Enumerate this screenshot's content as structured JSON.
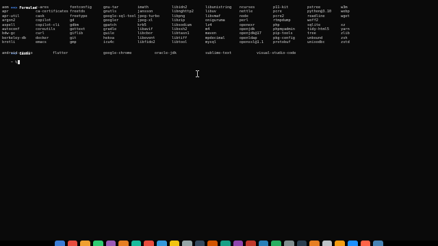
{
  "formulae": {
    "arrow": "==>",
    "title": "Formulae",
    "rows": [
      [
        "aom",
        "c-ares",
        "fontconfig",
        "gnu-tar",
        "imath",
        "libidn2",
        "libunistring",
        "ncurses",
        "p11-kit",
        "pstree",
        "w3m"
      ],
      [
        "apr",
        "ca-certificates",
        "freetds",
        "gnutls",
        "jansson",
        "libnghttp2",
        "libuv",
        "nettle",
        "pcre",
        "python@3.10",
        "webp"
      ],
      [
        "apr-util",
        "cask",
        "freetype",
        "google-sql-tool",
        "jpeg-turbo",
        "libpng",
        "libvmaf",
        "node",
        "pcre2",
        "readline",
        "wget"
      ],
      [
        "argon2",
        "copilot",
        "gd",
        "googler",
        "jpeg-xl",
        "libzip",
        "oniguruma",
        "perl",
        "rtmpdump",
        "woff2"
      ],
      [
        "aspell",
        "copilot-cli",
        "gdbm",
        "gpatch",
        "krb5",
        "libsodium",
        "lz4",
        "openexr",
        "php",
        "sqlite",
        "xz"
      ],
      [
        "autoconf",
        "coreutils",
        "gettext",
        "gradle",
        "libavif",
        "libssh2",
        "m4",
        "openjdk",
        "phpmyadmin",
        "tidy-html5",
        "yarn"
      ],
      [
        "bdw-gc",
        "curl",
        "giflib",
        "guile",
        "libcbor",
        "libtasn1",
        "maven",
        "openjdk@17",
        "pip-tools",
        "tree",
        "zlib"
      ],
      [
        "berkeley-db",
        "docker",
        "git",
        "hekxa",
        "libevent",
        "libtiff",
        "mpdecimal",
        "openldap",
        "pkg-config",
        "unbound",
        "zsh"
      ],
      [
        "brotli",
        "emacs",
        "gmp",
        "icu4c",
        "libfido2",
        "libtool",
        "mysql",
        "openssl@1.1",
        "protobuf",
        "unixodbc",
        "zstd"
      ]
    ]
  },
  "casks": {
    "arrow": "==>",
    "title": "Casks",
    "items": [
      "android-studio",
      "flutter",
      "google-chrome",
      "oracle-jdk",
      "sublime-text",
      "visual-studio-code"
    ]
  },
  "prompt": {
    "text": "~ %"
  },
  "dock": {
    "icon_colors": [
      "#3a7bd5",
      "#e84c3d",
      "#f0a030",
      "#2ecc71",
      "#9b59b6",
      "#e67e22",
      "#1abc9c",
      "#e74c3c",
      "#3498db",
      "#f1c40f",
      "#95a5a6",
      "#34495e",
      "#d35400",
      "#16a085",
      "#8e44ad",
      "#c0392b",
      "#2980b9",
      "#27ae60",
      "#7f8c8d",
      "#2c3e50",
      "#e67e22",
      "#bdc3c7",
      "#f39c12",
      "#1e90ff",
      "#ff6347",
      "#4682b4"
    ]
  }
}
